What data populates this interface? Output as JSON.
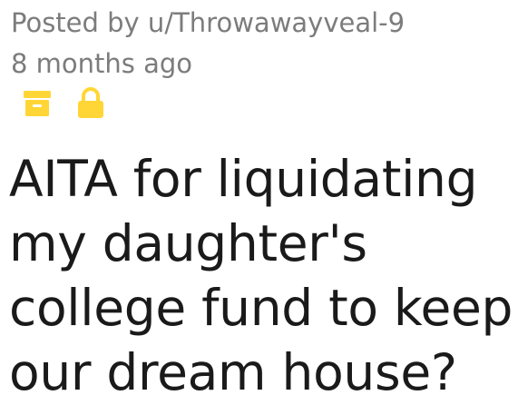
{
  "post": {
    "author_line": "Posted by u/Throwawayveal-9",
    "age": "8 months ago",
    "title": "AITA for liquidating my daughter's college fund to keep our dream house?"
  },
  "icons": {
    "archive": "archive-icon",
    "lock": "lock-icon"
  },
  "colors": {
    "meta_text": "#7c7c7c",
    "title_text": "#1a1a1b",
    "icon_yellow": "#ffd635"
  }
}
